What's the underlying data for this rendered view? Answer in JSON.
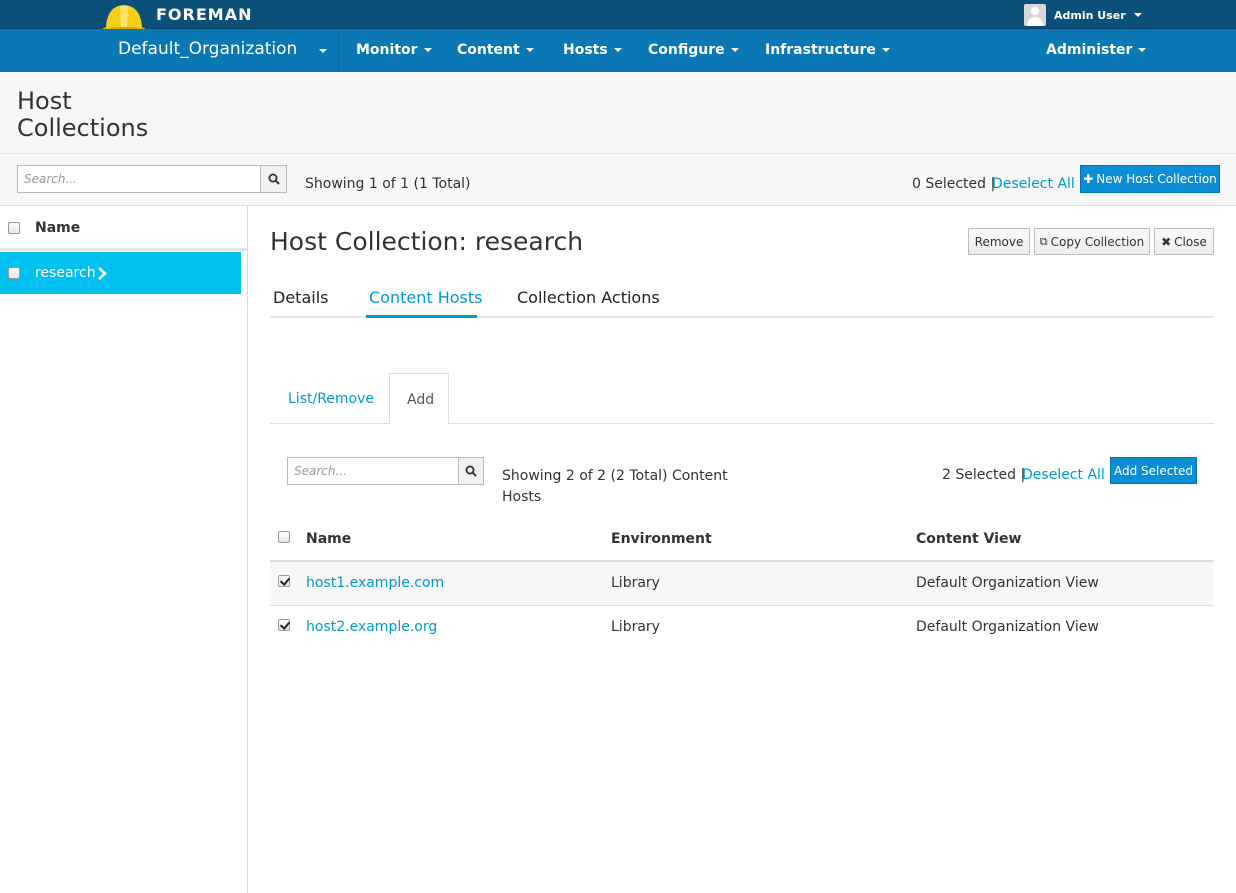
{
  "brand": "FOREMAN",
  "user": {
    "name": "Admin User"
  },
  "organization": "Default_Organization",
  "nav": [
    {
      "label": "Monitor"
    },
    {
      "label": "Content"
    },
    {
      "label": "Hosts"
    },
    {
      "label": "Configure"
    },
    {
      "label": "Infrastructure"
    },
    {
      "label": "Administer"
    }
  ],
  "page": {
    "title_line1": "Host",
    "title_line2": "Collections"
  },
  "list_toolbar": {
    "search_placeholder": "Search...",
    "showing": "Showing 1 of 1 (1 Total)",
    "selected": "0 Selected |",
    "deselect_all": "Deselect All",
    "new_button": "New Host Collection"
  },
  "collection_list": {
    "name_header": "Name",
    "items": [
      {
        "name": "research"
      }
    ]
  },
  "detail": {
    "title": "Host Collection: research",
    "remove_button": "Remove",
    "copy_button": "Copy Collection",
    "close_button": "Close",
    "tabs": [
      "Details",
      "Content Hosts",
      "Collection Actions"
    ],
    "subtabs": [
      "List/Remove",
      "Add"
    ]
  },
  "hosts_toolbar": {
    "search_placeholder": "Search...",
    "showing_line1": "Showing 2 of 2 (2 Total) Content",
    "showing_line2": "Hosts",
    "selected": "2 Selected |",
    "deselect_all": "Deselect All",
    "add_button": "Add Selected"
  },
  "hosts_table": {
    "headers": [
      "Name",
      "Environment",
      "Content View"
    ],
    "rows": [
      {
        "name": "host1.example.com",
        "environment": "Library",
        "content_view": "Default Organization View",
        "checked": true
      },
      {
        "name": "host2.example.org",
        "environment": "Library",
        "content_view": "Default Organization View",
        "checked": true
      }
    ]
  },
  "colors": {
    "topbar": "#0a5079",
    "navbar": "#0a78b4",
    "accent": "#0099d3",
    "selected_row": "#00c0f0"
  }
}
